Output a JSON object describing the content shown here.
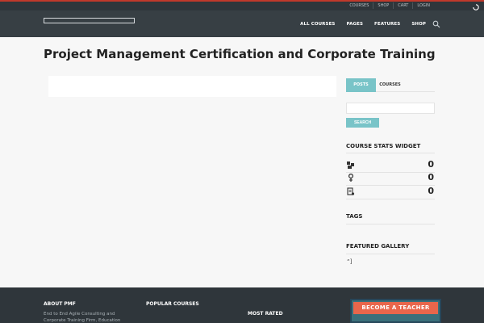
{
  "topbar": {
    "links": [
      "COURSES",
      "SHOP",
      "CART",
      "LOGIN"
    ]
  },
  "nav": {
    "items": [
      "ALL COURSES",
      "PAGES",
      "FEATURES",
      "SHOP"
    ]
  },
  "page": {
    "title": "Project Management Certification and Corporate Training"
  },
  "sidebar": {
    "tabs": [
      "POSTS",
      "COURSES"
    ],
    "search_button": "SEARCH",
    "stats_title": "COURSE STATS WIDGET",
    "stats": [
      {
        "icon": "students-icon",
        "value": "0"
      },
      {
        "icon": "instructor-icon",
        "value": "0"
      },
      {
        "icon": "certificate-icon",
        "value": "0"
      }
    ],
    "tags_title": "TAGS",
    "gallery_title": "FEATURED GALLERY",
    "gallery_text": "“]"
  },
  "footer": {
    "about_title": "ABOUT PMF",
    "about_text": "End to End Agile Consulting and Corporate Training Firm, Education",
    "popular_title": "POPULAR COURSES",
    "rated_title": "MOST RATED",
    "teacher_button": "BECOME A TEACHER"
  },
  "colors": {
    "accent": "#79c4c8",
    "header": "#373f44",
    "topline": "#c0392b",
    "cta": "#e8664b"
  }
}
